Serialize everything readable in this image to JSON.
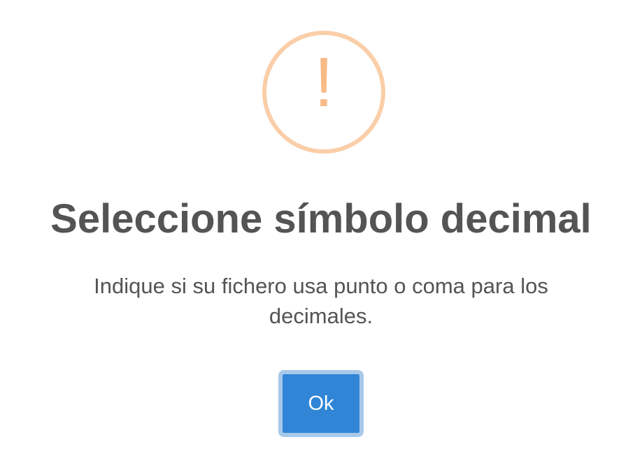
{
  "dialog": {
    "icon": {
      "name": "warning-icon",
      "glyph": "!",
      "color": "#f8bb86",
      "ring_color": "#facea8"
    },
    "title": "Seleccione símbolo decimal",
    "message": "Indique si su fichero usa punto o coma para los decimales.",
    "confirm_label": "Ok",
    "confirm_color": "#3085d6"
  }
}
